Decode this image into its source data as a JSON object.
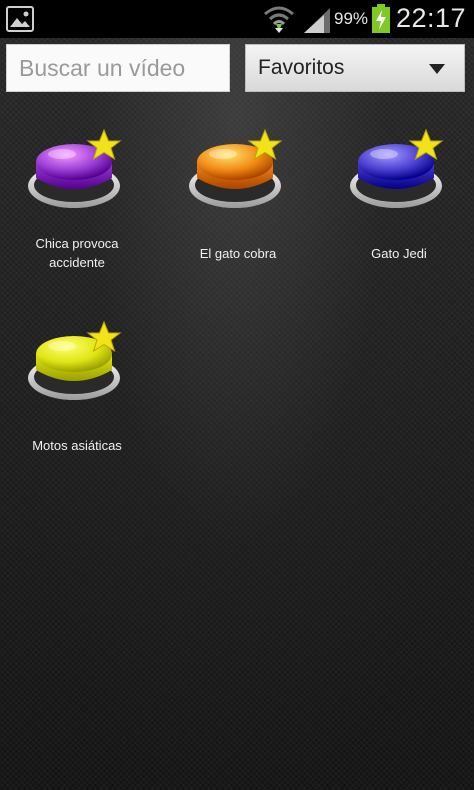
{
  "status_bar": {
    "battery_percent": "99%",
    "time": "22:17",
    "icons": [
      "gallery-icon",
      "wifi-icon",
      "signal-icon",
      "battery-icon"
    ]
  },
  "search": {
    "placeholder": "Buscar un vídeo",
    "value": ""
  },
  "filter": {
    "selected": "Favoritos"
  },
  "favorites": [
    {
      "label": "Chica provoca accidente",
      "color": "#9b3fd6"
    },
    {
      "label": "El gato cobra",
      "color": "#f28a14"
    },
    {
      "label": "Gato Jedi",
      "color": "#4a3fd0"
    },
    {
      "label": "Motos asiáticas",
      "color": "#e0e614"
    }
  ],
  "colors": {
    "star": "#f2e21a",
    "status_bar_bg": "#000000",
    "battery_green": "#7ec923"
  }
}
